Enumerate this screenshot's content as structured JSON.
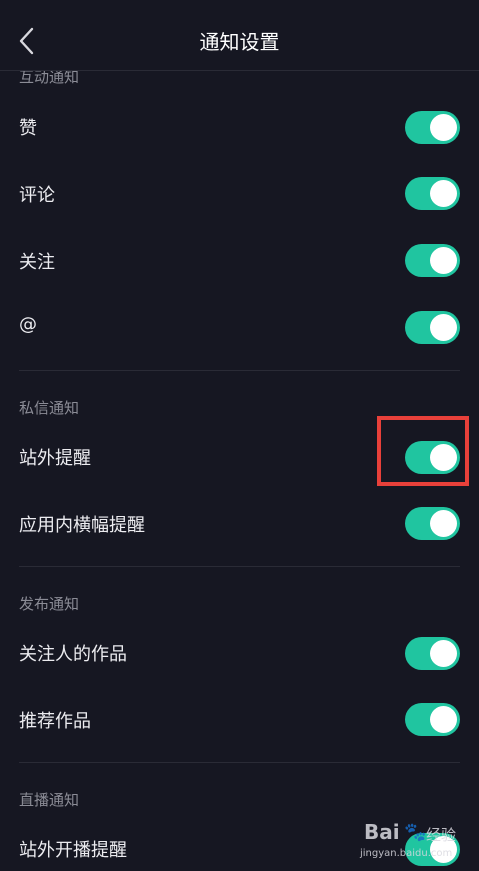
{
  "header": {
    "title": "通知设置"
  },
  "sections": [
    {
      "title": "互动通知",
      "items": [
        {
          "label": "赞",
          "on": true
        },
        {
          "label": "评论",
          "on": true
        },
        {
          "label": "关注",
          "on": true
        },
        {
          "label": "@",
          "on": true
        }
      ]
    },
    {
      "title": "私信通知",
      "items": [
        {
          "label": "站外提醒",
          "on": true
        },
        {
          "label": "应用内横幅提醒",
          "on": true
        }
      ]
    },
    {
      "title": "发布通知",
      "items": [
        {
          "label": "关注人的作品",
          "on": true
        },
        {
          "label": "推荐作品",
          "on": true
        }
      ]
    },
    {
      "title": "直播通知",
      "items": [
        {
          "label": "站外开播提醒",
          "on": true
        }
      ]
    }
  ],
  "colors": {
    "background": "#161722",
    "toggle_on": "#20c5a0",
    "highlight": "#e8403a"
  },
  "watermark": {
    "brand": "Bai",
    "paw": "🐾",
    "text": "经验",
    "url": "jingyan.baidu.com"
  }
}
